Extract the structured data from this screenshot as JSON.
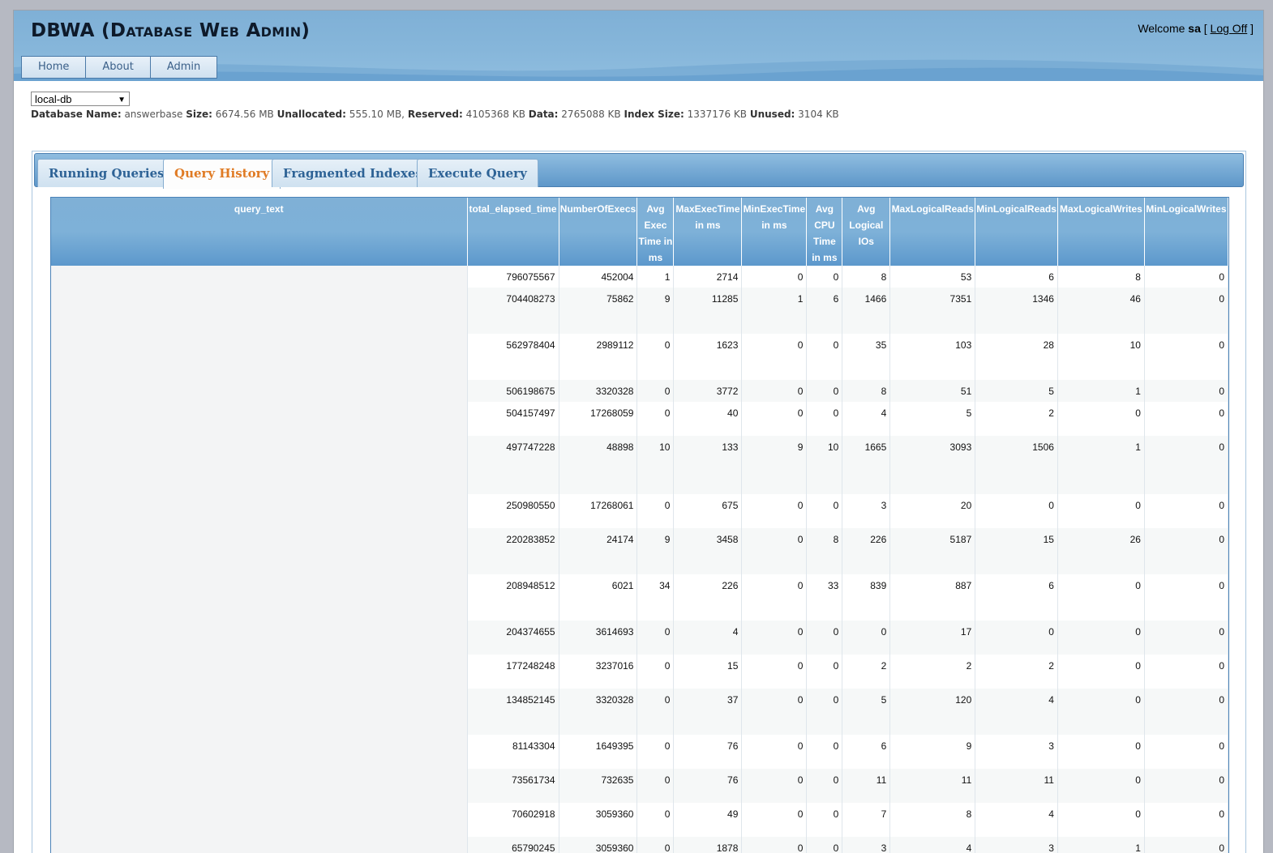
{
  "app": {
    "title": "DBWA (Database Web Admin)",
    "welcome_prefix": "Welcome",
    "user": "sa",
    "logoff_open": "[",
    "logoff_label": "Log Off",
    "logoff_close": "]"
  },
  "menu": [
    {
      "label": "Home"
    },
    {
      "label": "About"
    },
    {
      "label": "Admin"
    }
  ],
  "database_select": {
    "value": "local-db"
  },
  "db_info": {
    "name_label": "Database Name:",
    "name": "answerbase",
    "size_label": "Size:",
    "size": "6674.56 MB",
    "unallocated_label": "Unallocated:",
    "unallocated": "555.10 MB,",
    "reserved_label": "Reserved:",
    "reserved": "4105368 KB",
    "data_label": "Data:",
    "data": "2765088 KB",
    "index_label": "Index Size:",
    "index": "1337176 KB",
    "unused_label": "Unused:",
    "unused": "3104 KB"
  },
  "tabs": [
    {
      "label": "Running Queries",
      "active": false
    },
    {
      "label": "Query History",
      "active": true
    },
    {
      "label": "Fragmented Indexes",
      "active": false
    },
    {
      "label": "Execute Query",
      "active": false
    }
  ],
  "grid": {
    "columns": [
      "query_text",
      "total_elapsed_time",
      "NumberOfExecs",
      "Avg Exec Time in ms",
      "MaxExecTime in ms",
      "MinExecTime in ms",
      "Avg CPU Time in ms",
      "Avg Logical IOs",
      "MaxLogicalReads",
      "MinLogicalReads",
      "MaxLogicalWrites",
      "MinLogicalWrites"
    ],
    "rows": [
      [
        "796075567",
        "452004",
        "1",
        "2714",
        "0",
        "0",
        "8",
        "53",
        "6",
        "8",
        "0"
      ],
      [
        "704408273",
        "75862",
        "9",
        "11285",
        "1",
        "6",
        "1466",
        "7351",
        "1346",
        "46",
        "0"
      ],
      [
        "562978404",
        "2989112",
        "0",
        "1623",
        "0",
        "0",
        "35",
        "103",
        "28",
        "10",
        "0"
      ],
      [
        "506198675",
        "3320328",
        "0",
        "3772",
        "0",
        "0",
        "8",
        "51",
        "5",
        "1",
        "0"
      ],
      [
        "504157497",
        "17268059",
        "0",
        "40",
        "0",
        "0",
        "4",
        "5",
        "2",
        "0",
        "0"
      ],
      [
        "497747228",
        "48898",
        "10",
        "133",
        "9",
        "10",
        "1665",
        "3093",
        "1506",
        "1",
        "0"
      ],
      [
        "250980550",
        "17268061",
        "0",
        "675",
        "0",
        "0",
        "3",
        "20",
        "0",
        "0",
        "0"
      ],
      [
        "220283852",
        "24174",
        "9",
        "3458",
        "0",
        "8",
        "226",
        "5187",
        "15",
        "26",
        "0"
      ],
      [
        "208948512",
        "6021",
        "34",
        "226",
        "0",
        "33",
        "839",
        "887",
        "6",
        "0",
        "0"
      ],
      [
        "204374655",
        "3614693",
        "0",
        "4",
        "0",
        "0",
        "0",
        "17",
        "0",
        "0",
        "0"
      ],
      [
        "177248248",
        "3237016",
        "0",
        "15",
        "0",
        "0",
        "2",
        "2",
        "2",
        "0",
        "0"
      ],
      [
        "134852145",
        "3320328",
        "0",
        "37",
        "0",
        "0",
        "5",
        "120",
        "4",
        "0",
        "0"
      ],
      [
        "81143304",
        "1649395",
        "0",
        "76",
        "0",
        "0",
        "6",
        "9",
        "3",
        "0",
        "0"
      ],
      [
        "73561734",
        "732635",
        "0",
        "76",
        "0",
        "0",
        "11",
        "11",
        "11",
        "0",
        "0"
      ],
      [
        "70602918",
        "3059360",
        "0",
        "49",
        "0",
        "0",
        "7",
        "8",
        "4",
        "0",
        "0"
      ],
      [
        "65790245",
        "3059360",
        "0",
        "1878",
        "0",
        "0",
        "3",
        "4",
        "3",
        "1",
        "0"
      ]
    ]
  },
  "colors": {
    "header_blue": "#7fb0d6",
    "tab_active": "#e07b24",
    "tab_text": "#2e6396"
  }
}
